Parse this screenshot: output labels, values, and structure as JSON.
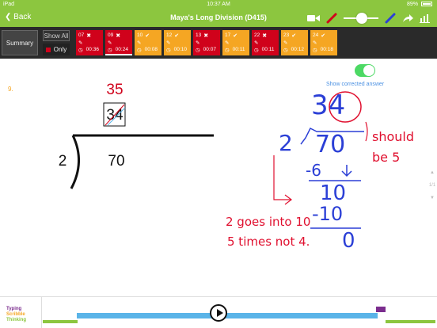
{
  "status": {
    "device": "iPad",
    "time": "10:37 AM",
    "battery": "89%"
  },
  "header": {
    "back_label": "Back",
    "title": "Maya's Long Division (D415)"
  },
  "toolbar": {
    "summary_label": "Summary",
    "show_all_label": "Show All",
    "only_label": "Only"
  },
  "answers": [
    {
      "num": "07",
      "mark": "✖",
      "time": "00:36",
      "color": "red"
    },
    {
      "num": "09",
      "mark": "✖",
      "time": "00:24",
      "color": "red"
    },
    {
      "num": "10",
      "mark": "✔",
      "time": "00:08",
      "color": "orange"
    },
    {
      "num": "12",
      "mark": "✔",
      "time": "00:10",
      "color": "orange"
    },
    {
      "num": "13",
      "mark": "✖",
      "time": "00:07",
      "color": "red"
    },
    {
      "num": "17",
      "mark": "✔",
      "time": "00:11",
      "color": "orange"
    },
    {
      "num": "22",
      "mark": "✖",
      "time": "00:11",
      "color": "red"
    },
    {
      "num": "23",
      "mark": "✔",
      "time": "00:12",
      "color": "orange"
    },
    {
      "num": "24",
      "mark": "✔",
      "time": "00:18",
      "color": "orange"
    }
  ],
  "question": {
    "number": "9.",
    "corrected_answer": "35",
    "student_answer": "34",
    "divisor": "2",
    "dividend": "70",
    "toggle_label": "Show corrected answer",
    "nav_page": "1/1"
  },
  "scribble": {
    "quotient": "34",
    "divisor": "2",
    "dividend": "70",
    "step1": "-6",
    "step2": "10",
    "step3": "-10",
    "remainder": "0",
    "note1": "should",
    "note2": "be 5",
    "note3": "2 goes into 10",
    "note4": "5 times not 4."
  },
  "legend": {
    "typing": "Typing",
    "scribble": "Scribble",
    "thinking": "Thinking"
  },
  "colors": {
    "header": "#8cc63f",
    "wrong": "#d0021b",
    "right": "#f5a623",
    "ink_blue": "#2b3fd6",
    "ink_red": "#e0102f"
  }
}
